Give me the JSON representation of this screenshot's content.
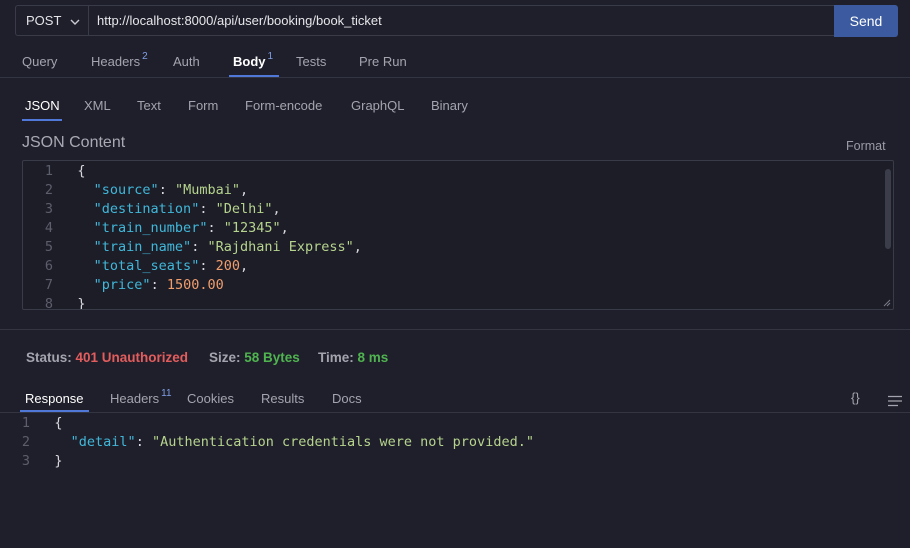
{
  "request": {
    "method": "POST",
    "url": "http://localhost:8000/api/user/booking/book_ticket",
    "send_label": "Send"
  },
  "request_tabs": [
    {
      "label": "Query"
    },
    {
      "label": "Headers",
      "badge": "2"
    },
    {
      "label": "Auth"
    },
    {
      "label": "Body",
      "badge": "1",
      "active": true
    },
    {
      "label": "Tests"
    },
    {
      "label": "Pre Run"
    }
  ],
  "body_tabs": [
    {
      "label": "JSON",
      "active": true
    },
    {
      "label": "XML"
    },
    {
      "label": "Text"
    },
    {
      "label": "Form"
    },
    {
      "label": "Form-encode"
    },
    {
      "label": "GraphQL"
    },
    {
      "label": "Binary"
    }
  ],
  "json_content_label": "JSON Content",
  "format_label": "Format",
  "request_body_lines": [
    {
      "num": "1",
      "indent": "",
      "key": "",
      "value": "",
      "type": "open",
      "text": "{"
    },
    {
      "num": "2",
      "indent": "  ",
      "key": "\"source\"",
      "value": "\"Mumbai\"",
      "type": "str",
      "comma": ","
    },
    {
      "num": "3",
      "indent": "  ",
      "key": "\"destination\"",
      "value": "\"Delhi\"",
      "type": "str",
      "comma": ","
    },
    {
      "num": "4",
      "indent": "  ",
      "key": "\"train_number\"",
      "value": "\"12345\"",
      "type": "str",
      "comma": ","
    },
    {
      "num": "5",
      "indent": "  ",
      "key": "\"train_name\"",
      "value": "\"Rajdhani Express\"",
      "type": "str",
      "comma": ","
    },
    {
      "num": "6",
      "indent": "  ",
      "key": "\"total_seats\"",
      "value": "200",
      "type": "num",
      "comma": ","
    },
    {
      "num": "7",
      "indent": "  ",
      "key": "\"price\"",
      "value": "1500.00",
      "type": "num",
      "comma": ""
    },
    {
      "num": "8",
      "indent": "",
      "key": "",
      "value": "",
      "type": "close",
      "text": "}"
    }
  ],
  "status": {
    "status_label": "Status:",
    "status_value": "401 Unauthorized",
    "size_label": "Size:",
    "size_value": "58 Bytes",
    "time_label": "Time:",
    "time_value": "8 ms"
  },
  "response_tabs": [
    {
      "label": "Response",
      "active": true
    },
    {
      "label": "Headers",
      "badge": "11"
    },
    {
      "label": "Cookies"
    },
    {
      "label": "Results"
    },
    {
      "label": "Docs"
    }
  ],
  "response_icons": {
    "braces": "{}",
    "menu": "menu-icon"
  },
  "response_body_lines": [
    {
      "num": "1",
      "text": "{",
      "type": "open"
    },
    {
      "num": "2",
      "indent": "  ",
      "key": "\"detail\"",
      "value": "\"Authentication credentials were not provided.\"",
      "type": "str",
      "comma": ""
    },
    {
      "num": "3",
      "text": "}",
      "type": "close"
    }
  ],
  "colors": {
    "accent": "#4f78d8",
    "send": "#3c5aa0",
    "error": "#e35d5d",
    "success": "#4fb44f"
  }
}
